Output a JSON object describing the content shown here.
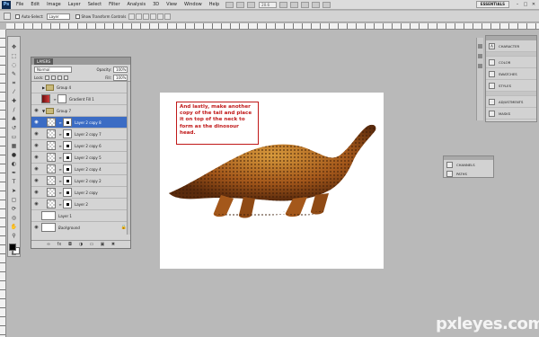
{
  "menu": {
    "logo": "Ps",
    "items": [
      "File",
      "Edit",
      "Image",
      "Layer",
      "Select",
      "Filter",
      "Analysis",
      "3D",
      "View",
      "Window",
      "Help"
    ],
    "zoom": "20.6",
    "workspace": "ESSENTIALS",
    "controls": [
      "–",
      "□",
      "✕"
    ]
  },
  "options": {
    "auto_select_label": "Auto-Select:",
    "auto_select_value": "Layer",
    "transform_label": "Show Transform Controls"
  },
  "layers_panel": {
    "tab": "LAYERS",
    "blend_mode": "Normal",
    "opacity_label": "Opacity:",
    "opacity_value": "100%",
    "lock_label": "Lock:",
    "fill_label": "Fill:",
    "fill_value": "100%",
    "layers": [
      {
        "name": "Group 4",
        "kind": "group",
        "expanded": false,
        "visible": false
      },
      {
        "name": "Gradient Fill 1",
        "kind": "gradient",
        "visible": false
      },
      {
        "name": "Group 7",
        "kind": "group",
        "expanded": true,
        "visible": true
      },
      {
        "name": "Layer 2 copy 8",
        "kind": "layer",
        "visible": true,
        "active": true
      },
      {
        "name": "Layer 2 copy 7",
        "kind": "layer",
        "visible": true
      },
      {
        "name": "Layer 2 copy 6",
        "kind": "layer",
        "visible": true
      },
      {
        "name": "Layer 2 copy 5",
        "kind": "layer",
        "visible": true
      },
      {
        "name": "Layer 2 copy 4",
        "kind": "layer",
        "visible": true
      },
      {
        "name": "Layer 2 copy 2",
        "kind": "layer",
        "visible": true
      },
      {
        "name": "Layer 2 copy",
        "kind": "layer",
        "visible": true
      },
      {
        "name": "Layer 2",
        "kind": "layer",
        "visible": true
      },
      {
        "name": "Layer 1",
        "kind": "plain",
        "visible": false
      },
      {
        "name": "Background",
        "kind": "background",
        "visible": true
      }
    ],
    "footer_icons": [
      "link-icon",
      "fx-icon",
      "mask-icon",
      "adjustment-icon",
      "folder-icon",
      "new-layer-icon",
      "trash-icon"
    ]
  },
  "canvas": {
    "callout_text": "And lastly, make another copy of the tail and place it on top of the neck to form as the dinosour head."
  },
  "dock": {
    "groups": [
      [
        {
          "label": "CHARACTER",
          "icon": "A"
        }
      ],
      [
        {
          "label": "COLOR",
          "icon": ""
        },
        {
          "label": "SWATCHES",
          "icon": ""
        },
        {
          "label": "STYLES",
          "icon": ""
        }
      ],
      [
        {
          "label": "ADJUSTMENTS",
          "icon": ""
        },
        {
          "label": "MASKS",
          "icon": ""
        }
      ]
    ]
  },
  "channels_panel": {
    "items": [
      {
        "label": "CHANNELS"
      },
      {
        "label": "PATHS"
      }
    ]
  },
  "watermark": "pxleyes.com"
}
